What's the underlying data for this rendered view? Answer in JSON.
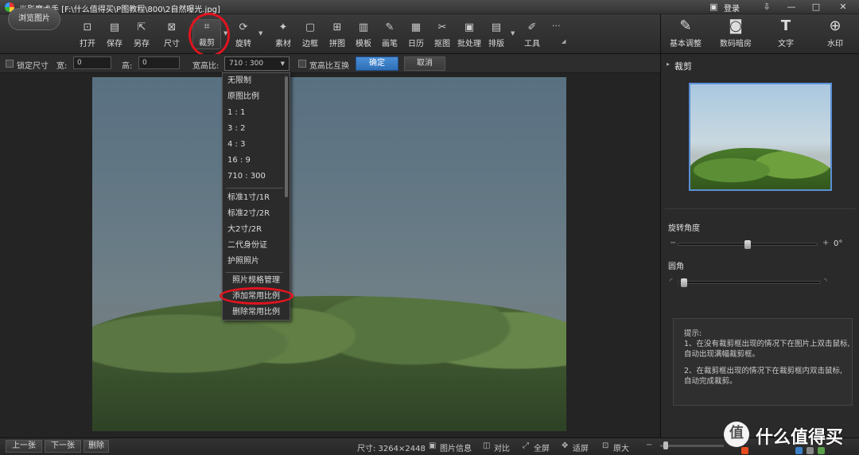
{
  "window": {
    "title": "光影魔术手 [F:\\什么值得买\\P图教程\\800\\2自然曝光.jpg]",
    "login_label": "登录",
    "controls": [
      "⇩",
      "—",
      "□",
      "✕"
    ]
  },
  "toolbar": {
    "browse_label": "浏览图片",
    "tools": [
      {
        "label": "打开",
        "icon": "open-icon"
      },
      {
        "label": "保存",
        "icon": "save-icon"
      },
      {
        "label": "另存",
        "icon": "save-as-icon"
      },
      {
        "label": "尺寸",
        "icon": "resize-icon"
      },
      {
        "label": "裁剪",
        "icon": "crop-icon"
      },
      {
        "label": "旋转",
        "icon": "rotate-icon"
      },
      {
        "label": "素材",
        "icon": "material-icon"
      },
      {
        "label": "边框",
        "icon": "frame-icon"
      },
      {
        "label": "拼图",
        "icon": "collage-icon"
      },
      {
        "label": "模板",
        "icon": "template-icon"
      },
      {
        "label": "画笔",
        "icon": "brush-icon"
      },
      {
        "label": "日历",
        "icon": "calendar-icon"
      },
      {
        "label": "抠图",
        "icon": "cutout-icon"
      },
      {
        "label": "批处理",
        "icon": "batch-icon"
      },
      {
        "label": "排版",
        "icon": "layout-icon"
      },
      {
        "label": "工具",
        "icon": "wrench-icon"
      }
    ],
    "more_label": "···"
  },
  "right_toolbar": [
    {
      "label": "基本调整",
      "icon": "edit-icon"
    },
    {
      "label": "数码暗房",
      "icon": "camera-icon"
    },
    {
      "label": "文字",
      "icon": "text-icon"
    },
    {
      "label": "水印",
      "icon": "watermark-icon"
    }
  ],
  "options": {
    "lock_size_label": "锁定尺寸",
    "width_label": "宽:",
    "width_value": "0",
    "height_label": "高:",
    "height_value": "0",
    "ratio_label": "宽高比:",
    "ratio_value": "710 : 300",
    "swap_label": "宽高比互换",
    "confirm_label": "确定",
    "cancel_label": "取消"
  },
  "ratio_menu": {
    "group1": [
      "无限制",
      "原图比例",
      "1 : 1",
      "3 : 2",
      "4 : 3",
      "16 : 9",
      "710 : 300"
    ],
    "group2": [
      "标准1寸/1R",
      "标准2寸/2R",
      "大2寸/2R",
      "二代身份证",
      "护照照片"
    ],
    "group3": [
      "照片规格管理",
      "添加常用比例",
      "删除常用比例"
    ]
  },
  "right_panel": {
    "section_title": "裁剪",
    "rotate_label": "旋转角度",
    "rotate_minus": "−",
    "rotate_plus": "+",
    "rotate_value": "0°",
    "rotate_level": 0.5,
    "corner_label": "圆角",
    "corner_level": 0.0,
    "hint_title": "提示:",
    "hint_lines": [
      "1、在没有裁剪框出现的情况下在图片上双击鼠标,",
      "自动出现满幅裁剪框。",
      "2、在裁剪框出现的情况下在裁剪框内双击鼠标,",
      "自动完成裁剪。"
    ]
  },
  "statusbar": {
    "prev_label": "上一张",
    "next_label": "下一张",
    "delete_label": "删除",
    "size_text": "尺寸: 3264×2448",
    "info_label": "图片信息",
    "compare_label": "对比",
    "fullscreen_label": "全屏",
    "fit_label": "适屏",
    "original_label": "原大"
  },
  "watermark": {
    "badge": "值",
    "text": "什么值得买"
  },
  "colors": {
    "annotation_red": "#e0141e",
    "accent_blue": "#3a7fc8"
  }
}
